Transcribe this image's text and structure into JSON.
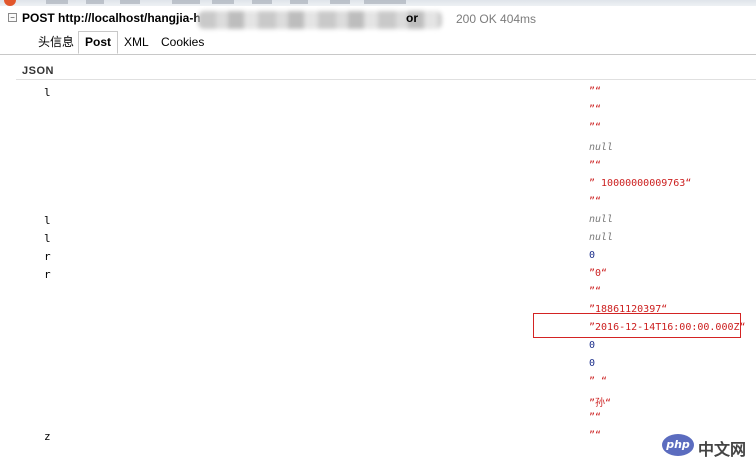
{
  "request": {
    "method_url_visible": "POST http://localhost/hangjia-h",
    "url_tail": "or",
    "status": "200 OK 404ms"
  },
  "tabs": [
    {
      "label": "头信息",
      "active": false
    },
    {
      "label": "Post",
      "active": true
    },
    {
      "label": "XML",
      "active": false
    },
    {
      "label": "Cookies",
      "active": false
    }
  ],
  "section": {
    "label": "JSON"
  },
  "rows": [
    {
      "key": "l",
      "value": "”“",
      "kind": "str"
    },
    {
      "key": "",
      "value": "”“",
      "kind": "str"
    },
    {
      "key": "",
      "value": "”“",
      "kind": "str"
    },
    {
      "key": "",
      "value": "null",
      "kind": "null"
    },
    {
      "key": "",
      "value": "”“",
      "kind": "str"
    },
    {
      "key": "",
      "value": "” 10000000009763“",
      "kind": "str"
    },
    {
      "key": "",
      "value": "”“",
      "kind": "str"
    },
    {
      "key": "l",
      "value": "null",
      "kind": "null"
    },
    {
      "key": "l",
      "value": "null",
      "kind": "null"
    },
    {
      "key": "r",
      "value": "0",
      "kind": "num"
    },
    {
      "key": "r",
      "value": "”0“",
      "kind": "str"
    },
    {
      "key": "",
      "value": "”“",
      "kind": "str"
    },
    {
      "key": "",
      "value": "”18861120397“",
      "kind": "str"
    },
    {
      "key": "",
      "value": "”2016-12-14T16:00:00.000Z“",
      "kind": "str"
    },
    {
      "key": "",
      "value": "0",
      "kind": "num"
    },
    {
      "key": "",
      "value": "0",
      "kind": "num"
    },
    {
      "key": "",
      "value": "” “",
      "kind": "str"
    },
    {
      "key": "",
      "value": "”孙“",
      "kind": "str"
    },
    {
      "key": "",
      "value": "”“",
      "kind": "str"
    },
    {
      "key": "z",
      "value": "”“",
      "kind": "str"
    }
  ],
  "watermark": {
    "badge": "php",
    "text": "中文网"
  },
  "colors": {
    "string": "#cc1f1f",
    "null": "#7a7a7a",
    "number": "#1c2f8c",
    "highlight": "#d32323"
  }
}
